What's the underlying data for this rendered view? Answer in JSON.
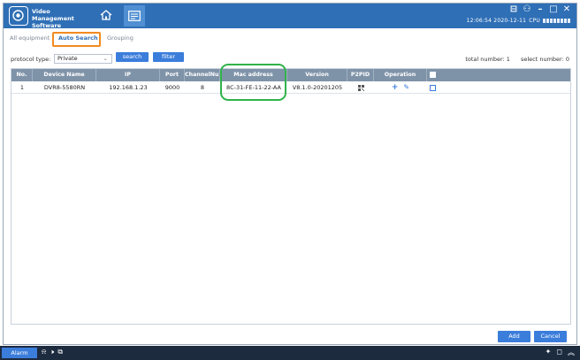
{
  "app": {
    "title_line1": "Video Management",
    "title_line2": "Software",
    "clock": "12:06:54 2020-12-11",
    "cpu_label": "CPU",
    "window_controls": [
      "⊟",
      "⚇",
      "–",
      "□",
      "✕"
    ]
  },
  "tabs": [
    {
      "label": "All equipment",
      "active": false
    },
    {
      "label": "Auto Search",
      "active": true
    },
    {
      "label": "Grouping",
      "active": false
    }
  ],
  "toolbar": {
    "protocol_label": "protocol type:",
    "protocol_value": "Private",
    "search_label": "search",
    "filter_label": "filter",
    "total_label": "total number: 1",
    "select_label": "select number: 0"
  },
  "table": {
    "headers": {
      "no": "No.",
      "device": "Device Name",
      "ip": "IP",
      "port": "Port",
      "channel": "ChannelNum",
      "mac": "Mac address",
      "version": "Version",
      "p2p": "P2PID",
      "operation": "Operation"
    },
    "rows": [
      {
        "no": "1",
        "device": "DVR8-5580RN",
        "ip": "192.168.1.23",
        "port": "9000",
        "channel": "8",
        "mac": "8C-31-FE-11-22-AA",
        "version": "V8.1.0-20201205",
        "p2p_icon": "qr-code-icon",
        "add_icon": "plus-icon",
        "edit_icon": "pencil-icon"
      }
    ]
  },
  "buttons": {
    "add": "Add",
    "cancel": "Cancel"
  },
  "taskbar": {
    "alarm": "Alarm"
  },
  "colors": {
    "titlebar": "#2f6fb6",
    "table_header": "#7f93a8",
    "button": "#3b7ddb",
    "tab_highlight": "#f28a1f",
    "mac_highlight": "#2fb34a",
    "taskbar": "#1d2b3f"
  }
}
